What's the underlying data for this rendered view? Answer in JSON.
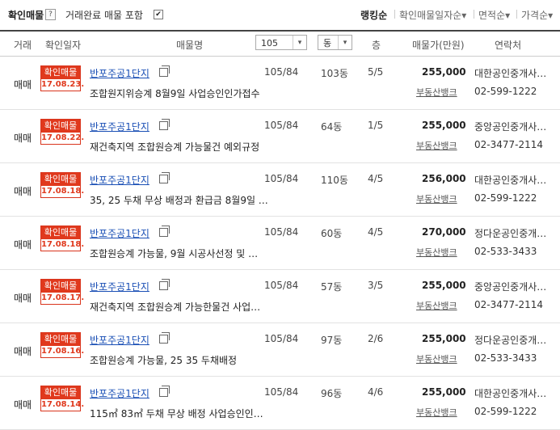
{
  "top": {
    "title": "확인매물",
    "help": "?",
    "include_label": "거래완료 매물 포함",
    "include_checked": "✔",
    "sorts": [
      {
        "label": "랭킹순",
        "active": true
      },
      {
        "label": "확인매물일자순▾",
        "active": false
      },
      {
        "label": "면적순▾",
        "active": false
      },
      {
        "label": "가격순▾",
        "active": false
      }
    ]
  },
  "header": {
    "type": "거래",
    "date": "확인일자",
    "name": "매물명",
    "area_select": "105",
    "dong_select": "동",
    "floor": "층",
    "price": "매물가(만원)",
    "contact": "연락처",
    "arrow": "▾"
  },
  "listings": [
    {
      "type": "매매",
      "badge": "확인매물",
      "date": "17.08.23.",
      "name": "반포주공1단지",
      "desc": "조합원지위승계 8월9일 사업승인인가접수",
      "area": "105/84",
      "dong": "103동",
      "floor": "5/5",
      "price": "255,000",
      "bank": "부동산뱅크",
      "agent": "대한공인중개사…",
      "phone": "02-599-1222"
    },
    {
      "type": "매매",
      "badge": "확인매물",
      "date": "17.08.22.",
      "name": "반포주공1단지",
      "desc": "재건축지역 조합원승계 가능물건 예외규정",
      "area": "105/84",
      "dong": "64동",
      "floor": "1/5",
      "price": "255,000",
      "bank": "부동산뱅크",
      "agent": "중앙공인중개사…",
      "phone": "02-3477-2114"
    },
    {
      "type": "매매",
      "badge": "확인매물",
      "date": "17.08.18.",
      "name": "반포주공1단지",
      "desc": "35, 25 두채 무상 배정과 환급금 8월9일 …",
      "area": "105/84",
      "dong": "110동",
      "floor": "4/5",
      "price": "256,000",
      "bank": "부동산뱅크",
      "agent": "대한공인중개사…",
      "phone": "02-599-1222"
    },
    {
      "type": "매매",
      "badge": "확인매물",
      "date": "17.08.18.",
      "name": "반포주공1단지",
      "desc": "조합원승계 가능물, 9월 시공사선정 및 …",
      "area": "105/84",
      "dong": "60동",
      "floor": "4/5",
      "price": "270,000",
      "bank": "부동산뱅크",
      "agent": "정다운공인중개…",
      "phone": "02-533-3433"
    },
    {
      "type": "매매",
      "badge": "확인매물",
      "date": "17.08.17.",
      "name": "반포주공1단지",
      "desc": "재건축지역 조합원승계 가능한물건 사업…",
      "area": "105/84",
      "dong": "57동",
      "floor": "3/5",
      "price": "255,000",
      "bank": "부동산뱅크",
      "agent": "중앙공인중개사…",
      "phone": "02-3477-2114"
    },
    {
      "type": "매매",
      "badge": "확인매물",
      "date": "17.08.16.",
      "name": "반포주공1단지",
      "desc": "조합원승계 가능물, 25 35 두채배정",
      "area": "105/84",
      "dong": "97동",
      "floor": "2/6",
      "price": "255,000",
      "bank": "부동산뱅크",
      "agent": "정다운공인중개…",
      "phone": "02-533-3433"
    },
    {
      "type": "매매",
      "badge": "확인매물",
      "date": "17.08.14.",
      "name": "반포주공1단지",
      "desc": "115㎡ 83㎡ 두채 무상 배정 사업승인인…",
      "area": "105/84",
      "dong": "96동",
      "floor": "4/6",
      "price": "255,000",
      "bank": "부동산뱅크",
      "agent": "대한공인중개사…",
      "phone": "02-599-1222"
    }
  ]
}
